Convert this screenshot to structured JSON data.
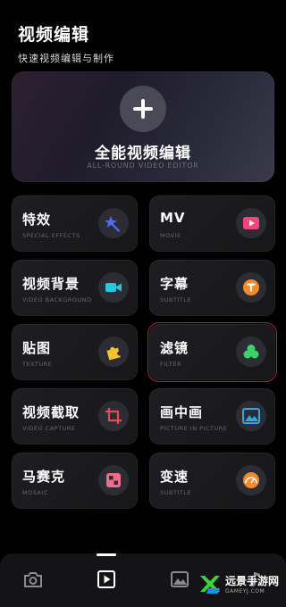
{
  "header": {
    "title": "视频编辑",
    "subtitle": "快速视频编辑与制作"
  },
  "hero": {
    "title": "全能视频编辑",
    "subtitle": "ALL-ROUND VIDEO EDITOR"
  },
  "cards": [
    {
      "title": "特效",
      "subtitle": "SPECIAL EFFECTS",
      "icon": "magic-wand-icon",
      "color": "#4a6cf7"
    },
    {
      "title": "MV",
      "subtitle": "MOVIE",
      "icon": "play-icon",
      "color": "#f0467a"
    },
    {
      "title": "视频背景",
      "subtitle": "VIDEO BACKGROUND",
      "icon": "video-camera-icon",
      "color": "#22c8e0"
    },
    {
      "title": "字幕",
      "subtitle": "SUBTITLE",
      "icon": "text-t-icon",
      "color": "#f28a2e"
    },
    {
      "title": "贴图",
      "subtitle": "TEXTURE",
      "icon": "puzzle-icon",
      "color": "#f5c332"
    },
    {
      "title": "滤镜",
      "subtitle": "FILTER",
      "icon": "filter-circles-icon",
      "color": "#3ed16c"
    },
    {
      "title": "视频截取",
      "subtitle": "VIDEO CAPTURE",
      "icon": "crop-icon",
      "color": "#e64b5c"
    },
    {
      "title": "画中画",
      "subtitle": "PICTURE IN PICTURE",
      "icon": "picture-icon",
      "color": "#2aa9e6"
    },
    {
      "title": "马赛克",
      "subtitle": "MOSAIC",
      "icon": "mosaic-icon",
      "color": "#f06b8c"
    },
    {
      "title": "变速",
      "subtitle": "SUBTITLE",
      "icon": "speed-gauge-icon",
      "color": "#f28a2e"
    }
  ],
  "bottom_nav": {
    "items": [
      {
        "icon": "camera-icon"
      },
      {
        "icon": "play-box-icon"
      },
      {
        "icon": "image-icon"
      }
    ],
    "active": 1
  },
  "watermark": {
    "text": "远景手游网",
    "site": "GAMEYJ.COM"
  }
}
